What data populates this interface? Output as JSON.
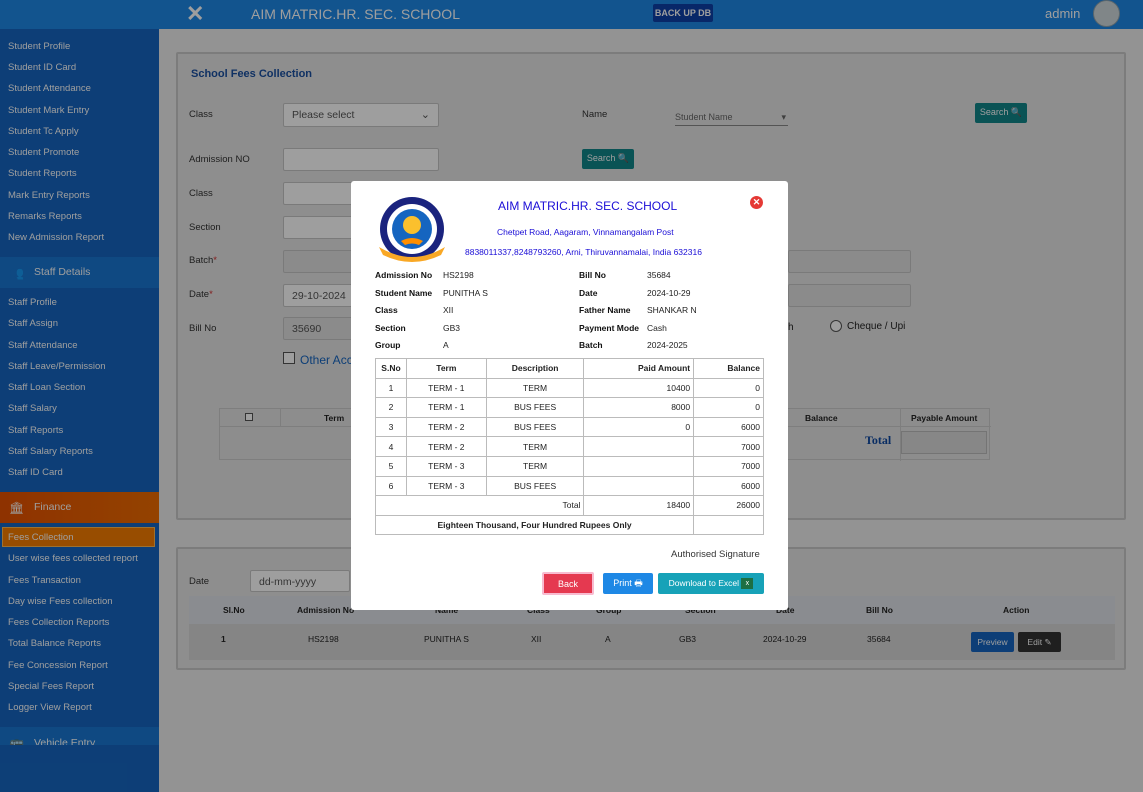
{
  "topbar": {
    "school": "AIM MATRIC.HR. SEC. SCHOOL",
    "backup": "BACK UP DB",
    "user": "admin"
  },
  "sidebar": {
    "student_items": [
      "Student Profile",
      "Student ID Card",
      "Student Attendance",
      "Student Mark Entry",
      "Student Tc Apply",
      "Student Promote",
      "Student Reports",
      "Mark Entry Reports",
      "Remarks Reports",
      "New Admission Report"
    ],
    "staff_header": "Staff Details",
    "staff_items": [
      "Staff Profile",
      "Staff Assign",
      "Staff Attendance",
      "Staff Leave/Permission",
      "Staff Loan Section",
      "Staff Salary",
      "Staff Reports",
      "Staff Salary Reports",
      "Staff ID Card"
    ],
    "finance_header": "Finance",
    "finance_items": [
      "Fees Collection",
      "User wise fees collected report",
      "Fees Transaction",
      "Day wise Fees collection",
      "Fees Collection Reports",
      "Total Balance Reports",
      "Fee Concession Report",
      "Special Fees Report",
      "Logger View Report"
    ],
    "vehicle_header": "Vehicle Entry"
  },
  "form": {
    "title": "School Fees Collection",
    "class_label": "Class",
    "class_placeholder": "Please select",
    "name_label": "Name",
    "name_placeholder": "Student Name",
    "search": "Search",
    "admission_label": "Admission NO",
    "class2_label": "Class",
    "section_label": "Section",
    "batch_label": "Batch",
    "date_label": "Date",
    "date_value": "29-10-2024",
    "bill_label": "Bill No",
    "bill_value": "35690",
    "other_acc": "Other Acc",
    "cash_partial": "h",
    "cheque": "Cheque / Upi",
    "table_headers": {
      "term": "Term",
      "balance": "Balance",
      "payable": "Payable Amount"
    },
    "total": "Total"
  },
  "lower": {
    "date_label": "Date",
    "date_placeholder": "dd-mm-yyyy",
    "headers": [
      "Sl.No",
      "Admission No",
      "Name",
      "Class",
      "Group",
      "Section",
      "Date",
      "Bill No",
      "Action"
    ],
    "row": [
      "1",
      "HS2198",
      "PUNITHA S",
      "XII",
      "A",
      "GB3",
      "2024-10-29",
      "35684"
    ],
    "preview": "Preview",
    "edit": "Edit"
  },
  "receipt": {
    "school": "AIM MATRIC.HR. SEC. SCHOOL",
    "address": "Chetpet Road, Aagaram, Vinnamangalam Post",
    "contact": "8838011337,8248793260, Arni, Thiruvannamalai, India 632316",
    "fields_left": [
      {
        "k": "Admission No",
        "v": "HS2198"
      },
      {
        "k": "Student Name",
        "v": "PUNITHA S"
      },
      {
        "k": "Class",
        "v": "XII"
      },
      {
        "k": "Section",
        "v": "GB3"
      },
      {
        "k": "Group",
        "v": "A"
      }
    ],
    "fields_right": [
      {
        "k": "Bill No",
        "v": "35684"
      },
      {
        "k": "Date",
        "v": "2024-10-29"
      },
      {
        "k": "Father Name",
        "v": "SHANKAR N"
      },
      {
        "k": "Payment Mode",
        "v": "Cash"
      },
      {
        "k": "Batch",
        "v": "2024-2025"
      }
    ],
    "headers": [
      "S.No",
      "Term",
      "Description",
      "Paid Amount",
      "Balance"
    ],
    "rows": [
      [
        "1",
        "TERM - 1",
        "TERM",
        "10400",
        "0"
      ],
      [
        "2",
        "TERM - 1",
        "BUS FEES",
        "8000",
        "0"
      ],
      [
        "3",
        "TERM - 2",
        "BUS FEES",
        "0",
        "6000"
      ],
      [
        "4",
        "TERM - 2",
        "TERM",
        "",
        "7000"
      ],
      [
        "5",
        "TERM - 3",
        "TERM",
        "",
        "7000"
      ],
      [
        "6",
        "TERM - 3",
        "BUS FEES",
        "",
        "6000"
      ]
    ],
    "total_label": "Total",
    "total_paid": "18400",
    "total_balance": "26000",
    "words": "Eighteen Thousand, Four Hundred Rupees Only",
    "signature": "Authorised Signature",
    "back": "Back",
    "print": "Print",
    "excel": "Download to Excel"
  }
}
